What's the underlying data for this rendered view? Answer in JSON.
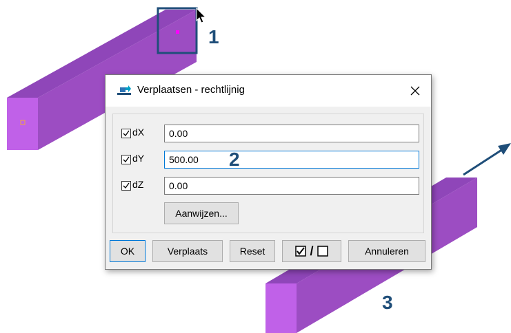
{
  "dialog": {
    "title": "Verplaatsen - rechtlijnig",
    "icon": "move-straight-icon",
    "rows": [
      {
        "label": "dX",
        "checked": true,
        "value": "0.00"
      },
      {
        "label": "dY",
        "checked": true,
        "value": "500.00"
      },
      {
        "label": "dZ",
        "checked": true,
        "value": "0.00"
      }
    ],
    "pick_button": "Aanwijzen...",
    "buttons": {
      "ok": "OK",
      "move": "Verplaats",
      "reset": "Reset",
      "toggle_separator": "/",
      "cancel": "Annuleren"
    }
  },
  "annotations": {
    "step1": "1",
    "step2": "2",
    "step3": "3"
  },
  "colors": {
    "beam_front": "#c061e8",
    "beam_top": "#8f46b9",
    "beam_side": "#9c4dc2",
    "annotation": "#1f4e79",
    "marker": "#ff00ff"
  }
}
